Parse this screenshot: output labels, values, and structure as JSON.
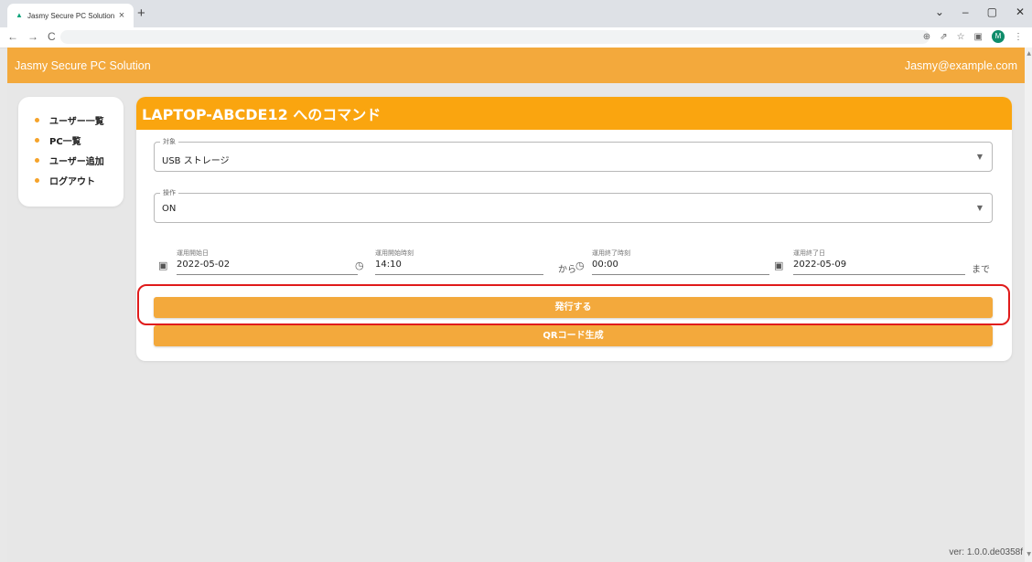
{
  "browser": {
    "tab_title": "Jasmy Secure PC Solution",
    "tab_close": "×",
    "new_tab": "+",
    "window_controls": [
      "⌄",
      "–",
      "▢",
      "✕"
    ],
    "nav": [
      "←",
      "→",
      "C"
    ],
    "toolbar_icons": [
      "⊕",
      "⇗",
      "☆",
      "▣"
    ],
    "profile_initial": "M",
    "menu": "⋮"
  },
  "header": {
    "app_title": "Jasmy Secure PC Solution",
    "user_email": "Jasmy@example.com"
  },
  "sidebar": {
    "items": [
      {
        "label": "ユーザー一覧"
      },
      {
        "label": "PC一覧"
      },
      {
        "label": "ユーザー追加"
      },
      {
        "label": "ログアウト"
      }
    ]
  },
  "card": {
    "title": "LAPTOP-ABCDE12 へのコマンド",
    "target": {
      "label": "対象",
      "value": "USB ストレージ"
    },
    "operation": {
      "label": "操作",
      "value": "ON"
    },
    "start_date": {
      "label": "運用開始日",
      "value": "2022-05-02"
    },
    "start_time": {
      "label": "運用開始時刻",
      "value": "14:10"
    },
    "from_text": "から",
    "end_time": {
      "label": "運用終了時刻",
      "value": "00:00"
    },
    "end_date": {
      "label": "運用終了日",
      "value": "2022-05-09"
    },
    "until_text": "まで",
    "issue_button": "発行する",
    "qr_button": "QRコード生成"
  },
  "footer": {
    "version": "ver: 1.0.0.de0358f"
  },
  "colors": {
    "header_bg": "#f3a93c",
    "card_header_bg": "#faa50f",
    "button_bg": "#f3a93c",
    "highlight": "#e01b1b",
    "bullet": "#f5a32a"
  }
}
